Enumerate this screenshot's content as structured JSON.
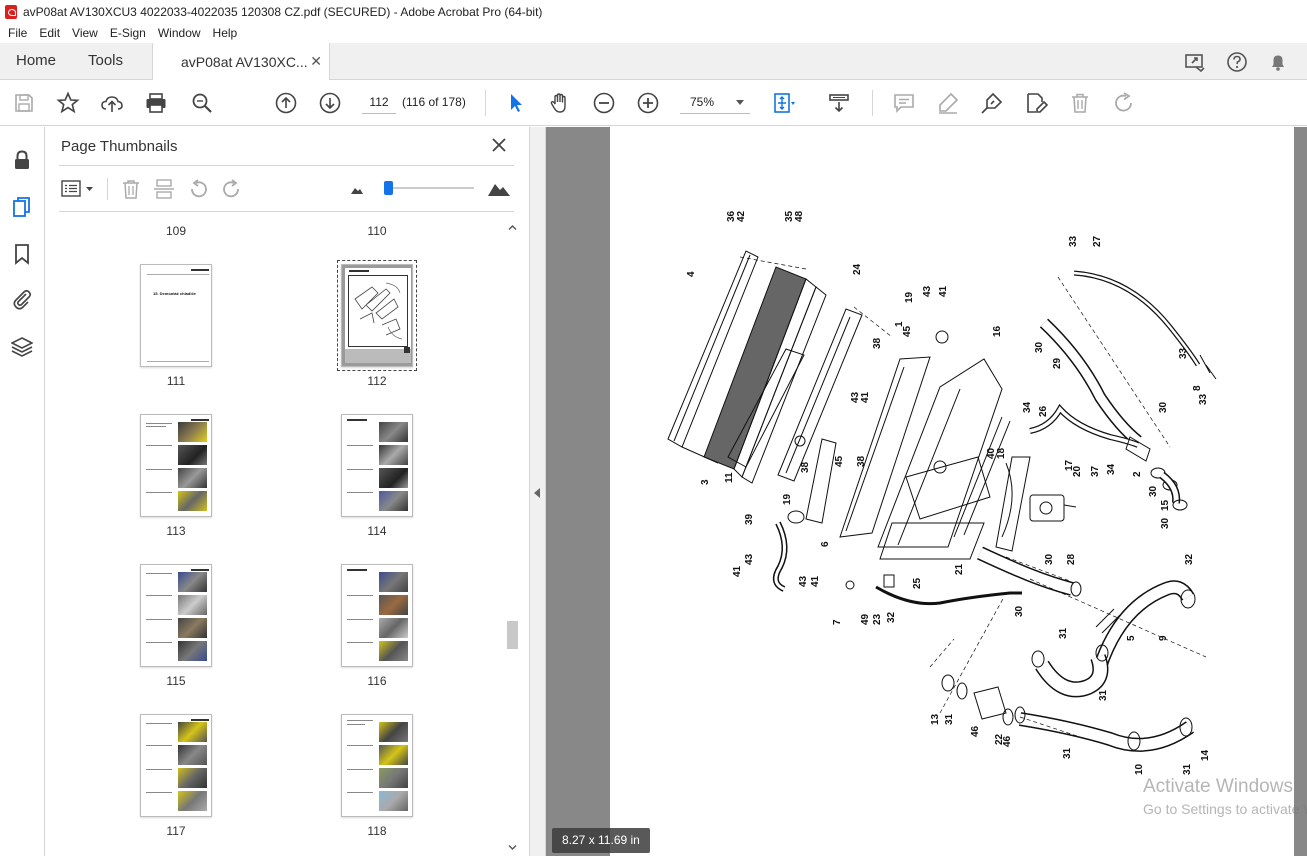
{
  "window": {
    "title": "avP08at AV130XCU3 4022033-4022035 120308 CZ.pdf (SECURED) - Adobe Acrobat Pro (64-bit)"
  },
  "menu": [
    "File",
    "Edit",
    "View",
    "E-Sign",
    "Window",
    "Help"
  ],
  "tabs": {
    "home": "Home",
    "tools": "Tools",
    "doc": "avP08at AV130XC..."
  },
  "toolbar": {
    "page_value": "112",
    "page_count": "(116 of 178)",
    "zoom": "75%"
  },
  "thumbnails": {
    "title": "Page Thumbnails",
    "pages": [
      "109",
      "110",
      "111",
      "112",
      "113",
      "114",
      "115",
      "116",
      "117",
      "118"
    ],
    "selected": "112",
    "page_111_heading": "15. Demontáž chladiče"
  },
  "doc": {
    "page_size": "8.27 x 11.69 in"
  },
  "watermark": {
    "line1": "Activate Windows",
    "line2": "Go to Settings to activate Windows."
  },
  "diagram": {
    "callouts": [
      "36",
      "42",
      "35",
      "48",
      "4",
      "24",
      "33",
      "27",
      "19",
      "43",
      "41",
      "1",
      "45",
      "38",
      "16",
      "30",
      "29",
      "33",
      "8",
      "33",
      "34",
      "26",
      "30",
      "43",
      "41",
      "38",
      "45",
      "38",
      "40",
      "18",
      "17",
      "20",
      "37",
      "34",
      "2",
      "30",
      "15",
      "30",
      "3",
      "11",
      "19",
      "6",
      "39",
      "43",
      "41",
      "43",
      "41",
      "7",
      "49",
      "23",
      "32",
      "25",
      "21",
      "30",
      "28",
      "30",
      "32",
      "5",
      "9",
      "31",
      "31",
      "13",
      "31",
      "46",
      "22",
      "46",
      "31",
      "10",
      "31",
      "14",
      "31"
    ]
  },
  "colors": {
    "accent": "#1473e6",
    "pdf_red": "#d8201c"
  }
}
